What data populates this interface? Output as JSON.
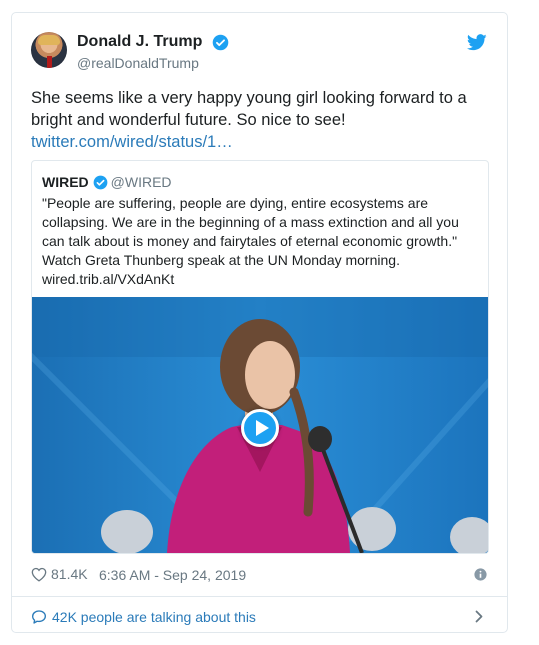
{
  "tweet": {
    "author_name": "Donald J. Trump",
    "author_handle": "@realDonaldTrump",
    "text": "She seems like a very happy young girl looking forward to a bright and wonderful future. So nice to see!",
    "link": "twitter.com/wired/status/1…",
    "likes": "81.4K",
    "timestamp": "6:36 AM - Sep 24, 2019",
    "talking": "42K people are talking about this"
  },
  "quote": {
    "name": "WIRED",
    "handle": "@WIRED",
    "text_line1": "\"People are suffering, people are dying, entire ecosystems are collapsing. We are in the beginning of a mass extinction and all you can talk about is money and fairytales of eternal economic growth.\"",
    "text_line2": "Watch Greta Thunberg speak at the UN Monday morning.",
    "link": "wired.trib.al/VXdAnKt"
  },
  "colors": {
    "link": "#2b7bb9",
    "twitter_blue": "#1da1f2",
    "secondary_text": "#697882",
    "border": "#e1e8ed"
  },
  "icons": [
    "verified-badge-icon",
    "twitter-bird-icon",
    "heart-icon",
    "info-icon",
    "speech-bubble-icon",
    "chevron-right-icon",
    "play-icon"
  ]
}
